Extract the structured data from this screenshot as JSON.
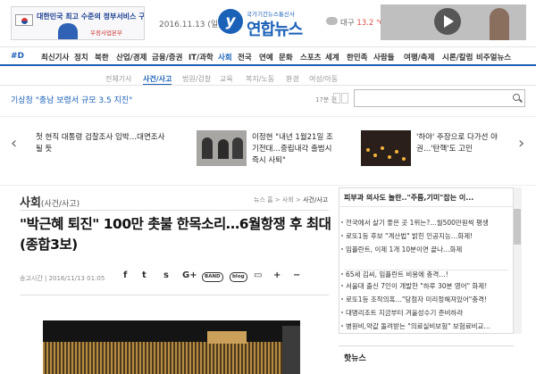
{
  "header": {
    "ad_left": {
      "line1": "대한민국 최고 수준의 정부서비스 구현",
      "line2": "우정사업본부",
      "brand": "KOREA POST"
    },
    "date": "2016.11.13 (일)",
    "logo": {
      "symbol": "y",
      "sub": "국가기간뉴스통신사",
      "name": "연합뉴스"
    },
    "weather": {
      "city": "대구",
      "temp": "13.2 ℃"
    }
  },
  "nav": {
    "hash": "#D",
    "items": [
      {
        "label": "최신기사",
        "active": false
      },
      {
        "label": "정치",
        "active": false
      },
      {
        "label": "북한",
        "active": false
      },
      {
        "label": "산업/경제",
        "active": false
      },
      {
        "label": "금융/증권",
        "active": false
      },
      {
        "label": "IT/과학",
        "active": false
      },
      {
        "label": "사회",
        "active": true
      },
      {
        "label": "전국",
        "active": false
      },
      {
        "label": "연예",
        "active": false
      },
      {
        "label": "문화",
        "active": false
      },
      {
        "label": "스포츠",
        "active": false
      },
      {
        "label": "세계",
        "active": false
      },
      {
        "label": "한민족",
        "active": false
      },
      {
        "label": "사람들",
        "active": false
      },
      {
        "label": "여행/축제",
        "active": false
      },
      {
        "label": "시론/칼럼",
        "active": false
      },
      {
        "label": "비주얼뉴스",
        "active": false
      }
    ]
  },
  "subnav": {
    "items": [
      {
        "label": "전체기사",
        "active": false
      },
      {
        "label": "사건/사고",
        "active": true
      },
      {
        "label": "법원/검찰",
        "active": false
      },
      {
        "label": "교육",
        "active": false
      },
      {
        "label": "복지/노동",
        "active": false
      },
      {
        "label": "환경",
        "active": false
      },
      {
        "label": "여성/아동",
        "active": false
      }
    ]
  },
  "ticker": {
    "label": "기상청",
    "text": "\"충남 보령서 규모 3.5 지진\"",
    "time": "17분 전"
  },
  "search": {
    "placeholder": ""
  },
  "carousel": [
    {
      "line1": "첫 현직 대통령 검찰조사 임박…대면조사",
      "line2": "될 듯"
    },
    {
      "line1": "이정현 \"내년 1월21일 조",
      "line2": "기전대…중립내각 출범시",
      "line3": "즉시 사퇴\""
    },
    {
      "line1": "'하야' 주장으로 다가선 야",
      "line2": "권…'탄핵'도 고민"
    }
  ],
  "article": {
    "section": "사회",
    "section_sub": "(사건/사고)",
    "breadcrumb": {
      "a": "뉴스 홈",
      "b": "사회",
      "current": "사건/사고"
    },
    "headline_line1": "\"박근혜 퇴진\" 100만 촛불 한목소리…6월항쟁 후 최대",
    "headline_line2": "(종합3보)",
    "meta": "송고시간 | 2016/11/13 01:05",
    "share": {
      "facebook": "f",
      "twitter": "t",
      "story": "s",
      "google": "G+",
      "band": "BAND",
      "blog": "blog",
      "more": "+",
      "minus": "−"
    }
  },
  "sidebar": {
    "title": "피부과 의사도 놀란..\"주름,기미\"잡는 이...",
    "items": [
      "전국에서 살기 좋은 곳 1위는?…월500만원씩 평생",
      "로또1등 후보 \"계산법\" 밝힌 인공지능…화제!",
      "임플란트, 이제 1개 10분이면 끝나…화제",
      "임플란트 비용에 충격…!",
      "65세 김씨, 임플란트 비용에 충격…!",
      "서울대 출신 7인이 개발한 \"하루 30분 영어\" 화제!",
      "로또1등 조작의혹…\"당첨자 미리정해져있어\"충격!",
      "대명리조트 지금부터 겨울성수기 준비하라",
      "병원비,약값 돌려받는 \"의료실비보험\" 보험료비교…"
    ],
    "hot_title": "핫뉴스"
  },
  "colors": {
    "accent": "#1b61b8",
    "temp": "#e0514b"
  }
}
